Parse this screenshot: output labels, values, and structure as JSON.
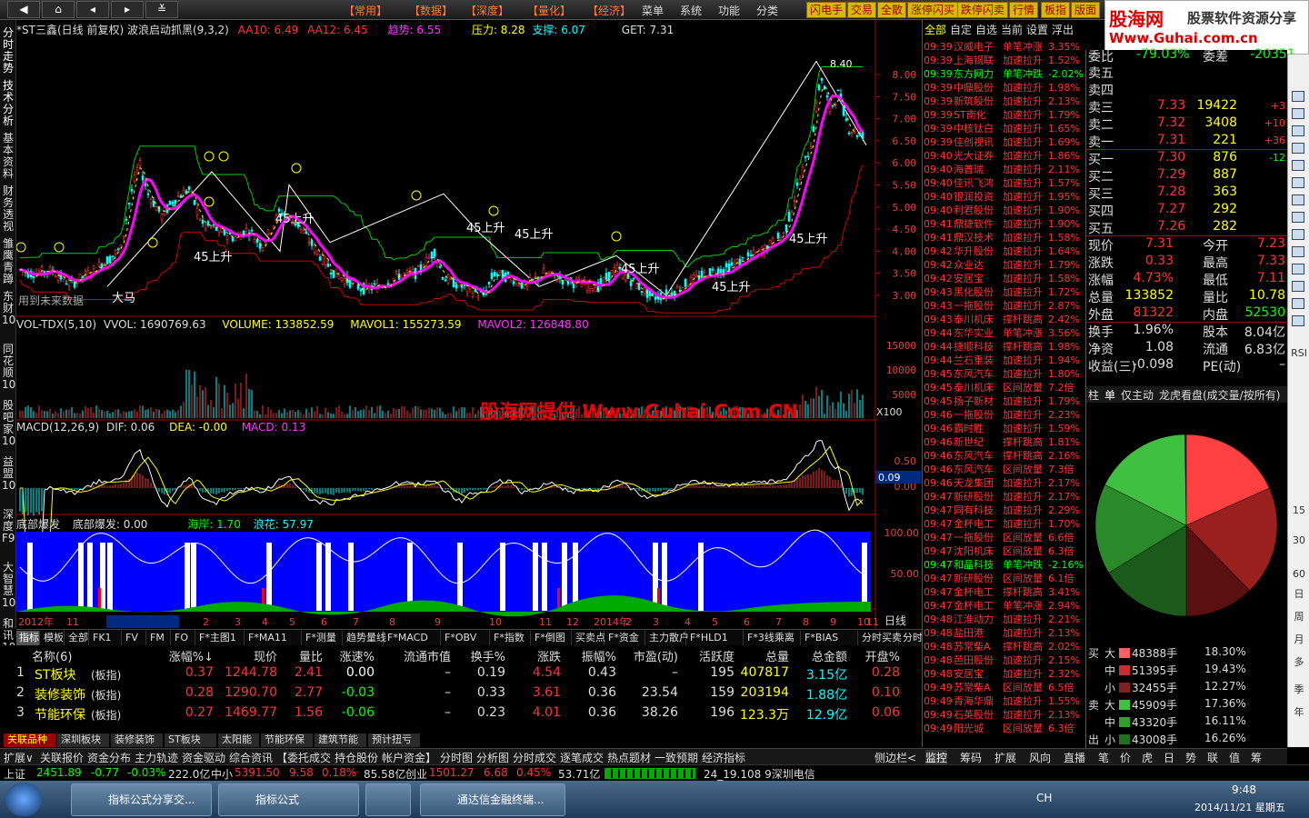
{
  "topbar": {
    "menus": [
      "【常用】",
      "【数据】",
      "【深度】",
      "【量化】",
      "【经济】",
      "菜单",
      "系统",
      "功能",
      "分类"
    ],
    "tabs": [
      "闪电手",
      "交易",
      "全散",
      "涨停闪买",
      "跌停闪卖",
      "行情",
      "板指",
      "版面"
    ]
  },
  "logo": {
    "title": "股海网",
    "slogan": "股票软件资源分享",
    "url": "Www.Guhai.com.cn"
  },
  "left_tabs": [
    "分时走势",
    "技术分析",
    "基本资料",
    "财务透视",
    "雏鹰青蹲",
    "东财10",
    "同花顺10",
    "股吧家10",
    "益盟10",
    "深度F9",
    "大智慧10",
    "和讯10"
  ],
  "chart": {
    "header": {
      "name": "*ST三鑫(日线 前复权) 波浪启动抓黑(9,3,2)",
      "aa10": "AA10: 6.49",
      "aa12": "AA12: 6.45",
      "trend": "趋势: 6.55",
      "pressure": "压力: 8.28",
      "support": "支撑: 6.07",
      "get": "GET: 7.31"
    },
    "note": "用到未来数据",
    "y_price": [
      "8.00",
      "7.50",
      "7.00",
      "6.50",
      "6.00",
      "5.50",
      "5.00",
      "4.50",
      "4.00",
      "3.50",
      "3.00"
    ],
    "high_label": "8.40",
    "labels": [
      "大马",
      "45上升",
      "45上升",
      "45上升",
      "45上升",
      "45上升",
      "45上升",
      "45上升"
    ],
    "vol_header": {
      "name": "VOL-TDX(5,10)",
      "vvol": "VVOL: 1690769.63",
      "volume": "VOLUME: 133852.59",
      "mavol1": "MAVOL1: 155273.59",
      "mavol2": "MAVOL2: 126848.80"
    },
    "y_vol": [
      "15000",
      "10000",
      "5000"
    ],
    "vol_unit": "X100",
    "watermark": "股海网提供 Www.Guhai.Com.CN",
    "macd_header": {
      "name": "MACD(12,26,9)",
      "dif": "DIF: 0.06",
      "dea": "DEA: -0.00",
      "macd": "MACD: 0.13"
    },
    "y_macd": [
      "0.50",
      "0.00"
    ],
    "macd_value": "0.09",
    "bd_header": {
      "name": "底部爆发",
      "bd": "底部爆发: 0.00",
      "haian": "海岸: 1.70",
      "langhua": "浪花: 57.97"
    },
    "y_bd": [
      "100.00",
      "50.00"
    ],
    "xaxis": [
      "2012年",
      "11",
      "2012/12/10/一",
      "2",
      "3",
      "4",
      "5",
      "6",
      "7",
      "8",
      "9",
      "10",
      "11",
      "12",
      "2014年",
      "2",
      "3",
      "4",
      "5",
      "6",
      "7",
      "8",
      "9",
      "10",
      "11"
    ],
    "period": "日线"
  },
  "bottom_tabs": [
    "指标",
    "模板",
    "全部",
    "FK1",
    "FV",
    "FM",
    "FO",
    "F*主图1",
    "F*MA11",
    "F*测量",
    "趋势量线",
    "F*MACD",
    "F*OBV",
    "F*指数",
    "F*倒图",
    "买卖点",
    "F*资金",
    "主力散户",
    "F*HLD1",
    "F*3线乘离",
    "F*BIAS",
    "分时买卖",
    "分时涨停"
  ],
  "table": {
    "headers": [
      "名称(6)",
      "涨幅%↓",
      "现价",
      "量比",
      "涨速%",
      "流通市值",
      "换手%",
      "涨跌",
      "振幅%",
      "市盈(动)",
      "活跃度",
      "总量",
      "总金额",
      "开盘%"
    ],
    "rows": [
      [
        "1",
        "ST板块",
        "(板指)",
        "0.37",
        "1244.78",
        "2.41",
        "0.00",
        "–",
        "0.19",
        "4.54",
        "0.43",
        "–",
        "195",
        "407817",
        "3.15亿",
        "0.28"
      ],
      [
        "2",
        "装修装饰",
        "(板指)",
        "0.28",
        "1290.70",
        "2.77",
        "-0.03",
        "–",
        "0.33",
        "3.61",
        "0.36",
        "23.54",
        "159",
        "203194",
        "1.88亿",
        "0.10"
      ],
      [
        "3",
        "节能环保",
        "(板指)",
        "0.27",
        "1469.77",
        "1.56",
        "-0.06",
        "–",
        "0.23",
        "4.01",
        "0.36",
        "38.26",
        "196",
        "123.3万",
        "12.9亿",
        "0.06"
      ]
    ]
  },
  "sector_tabs": [
    "关联品种",
    "深圳板块",
    "装修装饰",
    "ST板块",
    "太阳能",
    "节能环保",
    "建筑节能",
    "预计扭亏"
  ],
  "func_bar": [
    "扩展∨",
    "关联报价",
    "资金分布",
    "主力轨迹",
    "资金驱动",
    "综合资讯",
    "【委托成交",
    "持仓股份",
    "帐户资金】",
    "分时图",
    "分析图",
    "分时成交",
    "逐笔成交",
    "热点题材",
    "一致预期",
    "经济指标",
    "侧边栏<"
  ],
  "tick_panel": {
    "tabs": [
      "全部",
      "自定",
      "自选",
      "当前",
      "设置",
      "浮出"
    ],
    "rows": [
      [
        "09:39",
        "汉威电子",
        "单笔冲涨",
        "3.35%"
      ],
      [
        "09:39",
        "上海钢联",
        "加速拉升",
        "1.52%"
      ],
      [
        "09:39",
        "东方网力",
        "单笔冲跌",
        "-2.02%"
      ],
      [
        "09:39",
        "中鼎股份",
        "加速拉升",
        "1.98%"
      ],
      [
        "09:39",
        "新筑股份",
        "加速拉升",
        "2.13%"
      ],
      [
        "09:39",
        "ST南化",
        "加速拉升",
        "1.79%"
      ],
      [
        "09:39",
        "中核钛白",
        "加速拉升",
        "1.65%"
      ],
      [
        "09:39",
        "佳创视讯",
        "加速拉升",
        "1.69%"
      ],
      [
        "09:40",
        "光大证券",
        "加速拉升",
        "1.86%"
      ],
      [
        "09:40",
        "海普瑞",
        "加速拉升",
        "2.11%"
      ],
      [
        "09:40",
        "佳讯飞鸿",
        "加速拉升",
        "1.57%"
      ],
      [
        "09:40",
        "银润投资",
        "加速拉升",
        "1.95%"
      ],
      [
        "09:40",
        "利君股份",
        "加速拉升",
        "1.90%"
      ],
      [
        "09:41",
        "鼎捷软件",
        "加速拉升",
        "1.90%"
      ],
      [
        "09:41",
        "鼎汉技术",
        "加速拉升",
        "1.58%"
      ],
      [
        "09:42",
        "华升股份",
        "加速拉升",
        "1.64%"
      ],
      [
        "09:42",
        "众业达",
        "加速拉升",
        "1.79%"
      ],
      [
        "09:42",
        "安居宝",
        "加速拉升",
        "1.58%"
      ],
      [
        "09:43",
        "黑化股份",
        "加速拉升",
        "1.72%"
      ],
      [
        "09:43",
        "一拖股份",
        "加速拉升",
        "2.87%"
      ],
      [
        "09:43",
        "泰川机床",
        "撑杆跳高",
        "2.42%"
      ],
      [
        "09:44",
        "东华实业",
        "单笔冲涨",
        "3.56%"
      ],
      [
        "09:44",
        "捷顺科技",
        "撑杆跳高",
        "1.98%"
      ],
      [
        "09:44",
        "兰石重装",
        "加速拉升",
        "1.94%"
      ],
      [
        "09:45",
        "东风汽车",
        "加速拉升",
        "1.80%"
      ],
      [
        "09:45",
        "泰川机床",
        "区间放量",
        "7.2倍"
      ],
      [
        "09:45",
        "扬子新材",
        "加速拉升",
        "1.79%"
      ],
      [
        "09:46",
        "一拖股份",
        "加速拉升",
        "2.23%"
      ],
      [
        "09:46",
        "霸时胜",
        "加速拉升",
        "1.59%"
      ],
      [
        "09:46",
        "新世纪",
        "撑杆跳高",
        "1.81%"
      ],
      [
        "09:46",
        "东风汽车",
        "撑杆跳高",
        "2.16%"
      ],
      [
        "09:46",
        "东风汽车",
        "区间放量",
        "7.3倍"
      ],
      [
        "09:46",
        "天龙集团",
        "加速拉升",
        "2.17%"
      ],
      [
        "09:47",
        "新研股份",
        "加速拉升",
        "2.17%"
      ],
      [
        "09:47",
        "同有科技",
        "加速拉升",
        "2.29%"
      ],
      [
        "09:47",
        "金杯电工",
        "加速拉升",
        "1.70%"
      ],
      [
        "09:47",
        "一拖股份",
        "区间放量",
        "6.6倍"
      ],
      [
        "09:47",
        "沈阳机床",
        "区间放量",
        "6.3倍"
      ],
      [
        "09:47",
        "和晶科技",
        "单笔冲跌",
        "-2.16%"
      ],
      [
        "09:47",
        "新研股份",
        "区间放量",
        "6.1倍"
      ],
      [
        "09:47",
        "金杯电工",
        "撑杆跳高",
        "3.41%"
      ],
      [
        "09:47",
        "金杯电工",
        "单笔冲涨",
        "2.94%"
      ],
      [
        "09:48",
        "江淮动力",
        "加速拉升",
        "2.21%"
      ],
      [
        "09:48",
        "盐田港",
        "加速拉升",
        "2.13%"
      ],
      [
        "09:48",
        "苏常柴A",
        "撑杆跳高",
        "2.02%"
      ],
      [
        "09:48",
        "芭田股份",
        "加速拉升",
        "2.15%"
      ],
      [
        "09:48",
        "安居宝",
        "加速拉升",
        "2.32%"
      ],
      [
        "09:49",
        "苏常柴A",
        "区间放量",
        "6.5倍"
      ],
      [
        "09:49",
        "青海华鼎",
        "加速拉升",
        "1.55%"
      ],
      [
        "09:49",
        "石英股份",
        "加速拉升",
        "2.13%"
      ],
      [
        "09:49",
        "阳光城",
        "区间放量",
        "6.3倍"
      ]
    ]
  },
  "quote": {
    "weibi": [
      "委比",
      "-79.03%",
      "委差",
      "-20351"
    ],
    "sells": [
      [
        "卖五",
        "",
        ""
      ],
      [
        "卖四",
        "",
        ""
      ],
      [
        "卖三",
        "7.33",
        "19422",
        "+3"
      ],
      [
        "卖二",
        "7.32",
        "3408",
        "+10"
      ],
      [
        "卖一",
        "7.31",
        "221",
        "+36"
      ]
    ],
    "buys": [
      [
        "买一",
        "7.30",
        "876",
        "-12"
      ],
      [
        "买二",
        "7.29",
        "887",
        ""
      ],
      [
        "买三",
        "7.28",
        "363",
        ""
      ],
      [
        "买四",
        "7.27",
        "292",
        ""
      ],
      [
        "买五",
        "7.26",
        "282",
        ""
      ]
    ],
    "stats": [
      [
        "现价",
        "7.31",
        "今开",
        "7.23"
      ],
      [
        "涨跌",
        "0.33",
        "最高",
        "7.33"
      ],
      [
        "涨幅",
        "4.73%",
        "最低",
        "7.11"
      ],
      [
        "总量",
        "133852",
        "量比",
        "10.78"
      ],
      [
        "外盘",
        "81322",
        "内盘",
        "52530"
      ]
    ],
    "stats2": [
      [
        "换手",
        "1.96%",
        "股本",
        "8.04亿"
      ],
      [
        "净资",
        "1.08",
        "流通",
        "6.83亿"
      ],
      [
        "收益(三)",
        "-0.098",
        "PE(动)",
        "–"
      ]
    ],
    "tabs": [
      "柱",
      "单",
      "仅主动",
      "龙虎看盘(成交量/按所有)"
    ]
  },
  "pie": {
    "slices": [
      {
        "label": "大买",
        "pct": 18.3,
        "color": "#ff4040"
      },
      {
        "label": "中买",
        "pct": 19.43,
        "color": "#9a2020"
      },
      {
        "label": "小买",
        "pct": 12.27,
        "color": "#5a1010"
      },
      {
        "label": "小卖",
        "pct": 16.26,
        "color": "#1a5a1a"
      },
      {
        "label": "中卖",
        "pct": 16.11,
        "color": "#2a8a2a"
      },
      {
        "label": "大卖",
        "pct": 17.36,
        "color": "#40c040"
      }
    ],
    "legend": [
      [
        "买",
        "大",
        "48388手",
        "18.30%",
        "#ff6060"
      ],
      [
        "",
        "中",
        "51395手",
        "19.43%",
        "#c03030"
      ],
      [
        "",
        "小",
        "32455手",
        "12.27%",
        "#802020"
      ],
      [
        "卖",
        "大",
        "45909手",
        "17.36%",
        "#40c040"
      ],
      [
        "",
        "中",
        "43320手",
        "16.11%",
        "#30a030"
      ],
      [
        "出",
        "小",
        "43008手",
        "16.26%",
        "#207020"
      ]
    ]
  },
  "right_bar": [
    "RSI",
    "15",
    "30",
    "60",
    "日",
    "周",
    "月",
    "多",
    "季",
    "年"
  ],
  "right_tabs": [
    "监控",
    "筹码",
    "扩展",
    "风向",
    "直播",
    "笔",
    "价",
    "虎",
    "日",
    "势",
    "联",
    "值",
    "筹"
  ],
  "status": {
    "sh": "上证",
    "sh_val": "2451.89",
    "sh_chg": "-0.77",
    "sh_pct": "-0.03%",
    "sh_amt": "222.0亿",
    "zx": "中小",
    "zx_val": "5391.50",
    "zx_chg": "9.58",
    "zx_pct": "0.18%",
    "zx_amt": "85.58亿",
    "cy": "创业",
    "cy_val": "1501.27",
    "cy_chg": "6.68",
    "cy_pct": "0.45%",
    "cy_amt": "53.71亿",
    "server": "24_19.108 9深圳电信"
  },
  "taskbar": {
    "items": [
      "指标公式分享交...",
      "指标公式",
      "",
      "通达信金融终端..."
    ],
    "time": "9:48",
    "date": "2014/11/21 星期五",
    "lang": "CH"
  }
}
